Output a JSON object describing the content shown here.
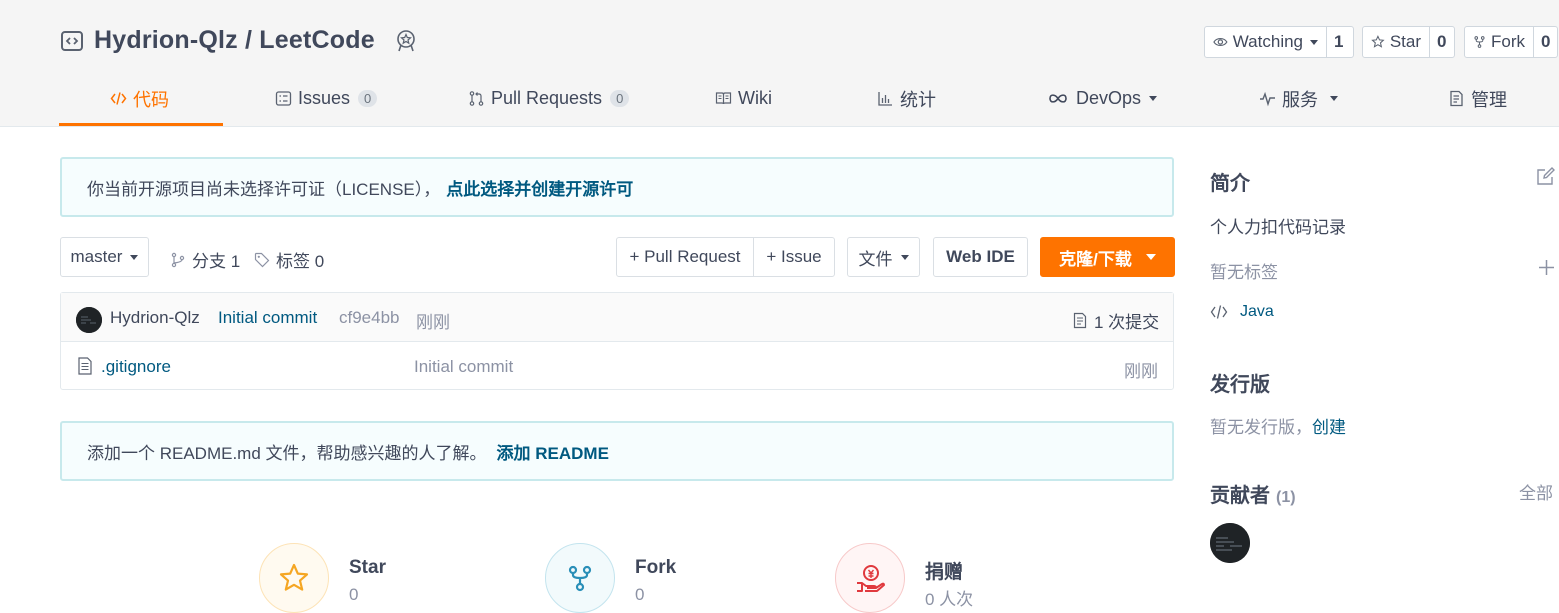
{
  "repo": {
    "owner_repo": "Hydrion-Qlz / LeetCode"
  },
  "actions": {
    "watch": {
      "label": "Watching",
      "count": "1"
    },
    "star": {
      "label": "Star",
      "count": "0"
    },
    "fork": {
      "label": "Fork",
      "count": "0"
    }
  },
  "tabs": [
    {
      "label": "代码"
    },
    {
      "label": "Issues",
      "count": "0"
    },
    {
      "label": "Pull Requests",
      "count": "0"
    },
    {
      "label": "Wiki"
    },
    {
      "label": "统计"
    },
    {
      "label": "DevOps"
    },
    {
      "label": "服务"
    },
    {
      "label": "管理"
    }
  ],
  "license_notice": {
    "text": "你当前开源项目尚未选择许可证（LICENSE），",
    "link": "点此选择并创建开源许可"
  },
  "toolbar": {
    "branch": "master",
    "branches": "分支 1",
    "tags": "标签 0",
    "pull_request": "+ Pull Request",
    "issue": "+ Issue",
    "file": "文件",
    "web_ide": "Web IDE",
    "clone": "克隆/下载"
  },
  "commit": {
    "author": "Hydrion-Qlz",
    "message": "Initial commit",
    "hash": "cf9e4bb",
    "time": "刚刚",
    "count": "1 次提交"
  },
  "files": [
    {
      "name": ".gitignore",
      "message": "Initial commit",
      "time": "刚刚"
    }
  ],
  "readme_notice": {
    "text": "添加一个 README.md 文件，帮助感兴趣的人了解。",
    "link": "添加 README"
  },
  "sidebar": {
    "intro_title": "简介",
    "intro_desc": "个人力扣代码记录",
    "no_tags": "暂无标签",
    "language": "Java",
    "release_title": "发行版",
    "no_release": "暂无发行版，",
    "create_link": "创建",
    "contrib_title": "贡献者",
    "contrib_count": "(1)",
    "all_link": "全部"
  },
  "stats": [
    {
      "label": "Star",
      "value": "0"
    },
    {
      "label": "Fork",
      "value": "0"
    },
    {
      "label": "捐赠",
      "value": "0 人次"
    }
  ],
  "colors": {
    "accent": "#fe7300",
    "link": "#005980",
    "notice_bg": "#f6fdfe"
  }
}
